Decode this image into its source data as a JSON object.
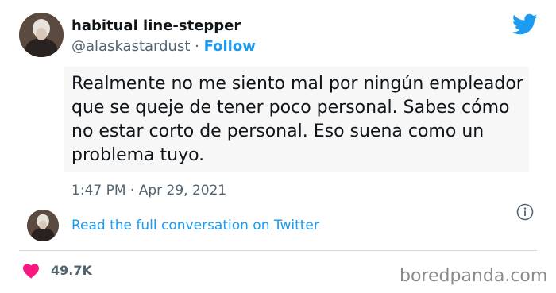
{
  "user": {
    "display_name": "habitual line-stepper",
    "handle": "@alaskastardust",
    "separator": " · ",
    "follow_label": "Follow"
  },
  "tweet": {
    "text": "Realmente no me siento mal por ningún empleador que se queje de tener poco personal. Sabes cómo no estar corto de personal. Eso suena como un problema tuyo.",
    "timestamp": "1:47 PM · Apr 29, 2021"
  },
  "conversation": {
    "link_label": "Read the full conversation on Twitter"
  },
  "stats": {
    "likes": "49.7K"
  },
  "watermark": {
    "text": "boredpanda.com"
  },
  "icons": {
    "brand": "twitter-bird-icon",
    "info": "info-icon",
    "like": "heart-icon"
  },
  "colors": {
    "twitter_blue": "#1d9bf0",
    "heart_red": "#f91880",
    "secondary_text": "#536471",
    "text_box_bg": "#f7f7f7"
  }
}
